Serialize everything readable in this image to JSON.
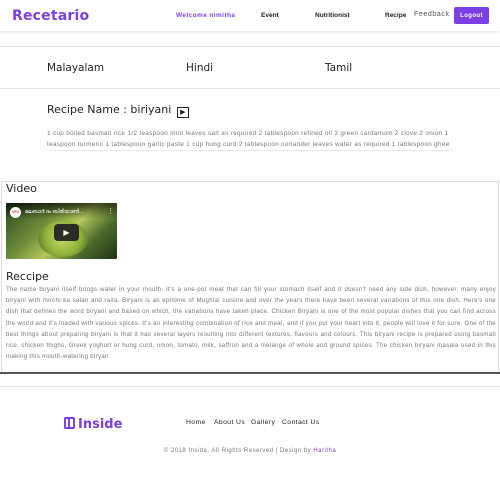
{
  "navbar": {
    "brand": "Recetario",
    "welcome": "Welcome nimitha",
    "event": "Event",
    "nutritionist": "Nutritionist",
    "recipe": "Recipe",
    "feedback": "Feedback",
    "logout": "Logout"
  },
  "languages": [
    "Malayalam",
    "Hindi",
    "Tamil"
  ],
  "recipe": {
    "name_label": "Recipe Name : biriyani",
    "play_symbol": "▶",
    "ingredients": "1 cup boiled basmati rice 1/2 teaspoon mint leaves salt as required 2 tablespoon refined oil 3 green cardamom 2 clove 2 onion 1 teaspoon turmeric 1 tablespoon garlic paste 1 cup hung curd 2 tablespoon coriander leaves water as required 1 tablespoon ghee"
  },
  "video": {
    "title": "Video",
    "channel_logo": "VFC",
    "caption": "മലബാർ ദം ബിരിയാണി...",
    "menu_symbol": "⋮",
    "play_symbol": "▶"
  },
  "description": {
    "title": "Reccipe",
    "text": "The name biryani itself brings water in your mouth. It's a one-pot meat that can fill your stomach itself and it doesn't need any side dish, however, many enjoy biryani with mirchi ka salan and raita. Biryani is an epitome of Mughlai cuisine and over the years there have been several variations of this one dish. Here's one dish that defines the word biryani and based on which, the variations have taken place. Chicken Biryani is one of the most popular dishes that you can find across the world and it's loaded with various spices. It's an interesting combination of rice and meat, and if you put your heart into it, people will love it for sure. One of the best things about preparing biryani is that it has several layers resulting into different textures, flavours and colours. This biryani recipe is prepared using basmati rice, chicken thighs, Greek yoghurt or hung curd, onion, tomato, milk, saffron and a melange of whole and ground spices. The chicken biryani masala used in this making this mouth-watering biryan"
  },
  "footer": {
    "logo_text": "Inside",
    "links": [
      "Home",
      "About Us",
      "Gallery",
      "Contact Us"
    ],
    "copyright_prefix": "© 2018 Inside. All Rights Reserved | Design by ",
    "copyright_author": "Haritha"
  },
  "colors": {
    "accent": "#7b3fe4"
  }
}
